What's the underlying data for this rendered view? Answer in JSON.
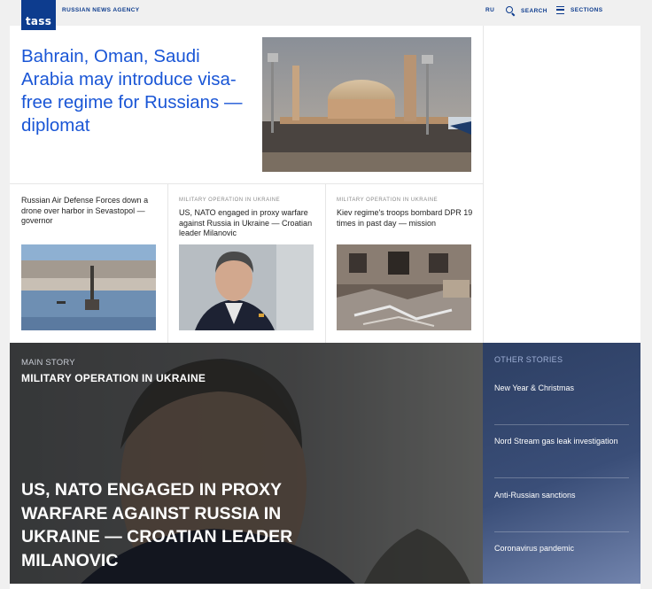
{
  "header": {
    "logo_text": "tass",
    "agency_name": "RUSSIAN NEWS AGENCY",
    "lang": "RU",
    "search_label": "SEARCH",
    "sections_label": "SECTIONS"
  },
  "lead": {
    "title": "Bahrain, Oman, Saudi Arabia may introduce visa-free regime for Russians — diplomat"
  },
  "cards": [
    {
      "tag": "",
      "title": "Russian Air Defense Forces down a drone over harbor in Sevastopol — governor"
    },
    {
      "tag": "MILITARY OPERATION IN UKRAINE",
      "title": "US, NATO engaged in proxy warfare against Russia in Ukraine — Croatian leader Milanovic"
    },
    {
      "tag": "MILITARY OPERATION IN UKRAINE",
      "title": "Kiev regime's troops bombard DPR 19 times in past day — mission"
    }
  ],
  "feature": {
    "label": "MAIN STORY",
    "kicker": "MILITARY OPERATION IN UKRAINE",
    "headline": "US, NATO engaged in proxy warfare against Russia in Ukraine — Croatian leader Milanovic"
  },
  "other_stories": {
    "heading": "OTHER STORIES",
    "items": [
      "New Year & Christmas",
      "Nord Stream gas leak investigation",
      "Anti-Russian sanctions",
      "Coronavirus pandemic"
    ]
  },
  "colors": {
    "brand": "#0d3c8e",
    "link": "#1a56d6"
  }
}
